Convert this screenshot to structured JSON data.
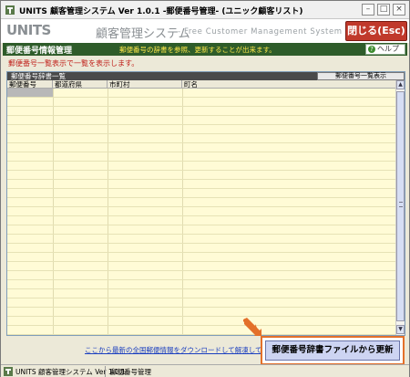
{
  "window": {
    "title": "UNITS 顧客管理システム  Ver 1.0.1 -郵便番号管理- (ユニック顧客リスト)"
  },
  "header": {
    "brand": "UNITS",
    "system_name": "顧客管理システム",
    "subtitle": "- Free Customer Management System -",
    "close_label": "閉じる(Esc)"
  },
  "section": {
    "title": "郵便番号情報管理",
    "description": "郵便番号の辞書を参照、更新することが出来ます。",
    "help_label": "ヘルプ"
  },
  "status_message": "郵便番号一覧表示で一覧を表示します。",
  "list": {
    "title": "郵便番号辞書一覧",
    "show_list_label": "郵便番号一覧表示",
    "columns": [
      "郵便番号",
      "都道府県",
      "市町村",
      "町名"
    ]
  },
  "download_link": "ここから最新の全国郵便情報をダウンロードして解凍してください。",
  "update_button": "郵便番号辞書ファイルから更新",
  "statusbar": {
    "app": "UNITS 顧客管理システム  Ver 1.0.1",
    "screen": "郵便番号管理"
  },
  "colors": {
    "accent_green": "#2e5c2a",
    "close_red": "#c0392b",
    "highlight_orange": "#e3702a"
  }
}
